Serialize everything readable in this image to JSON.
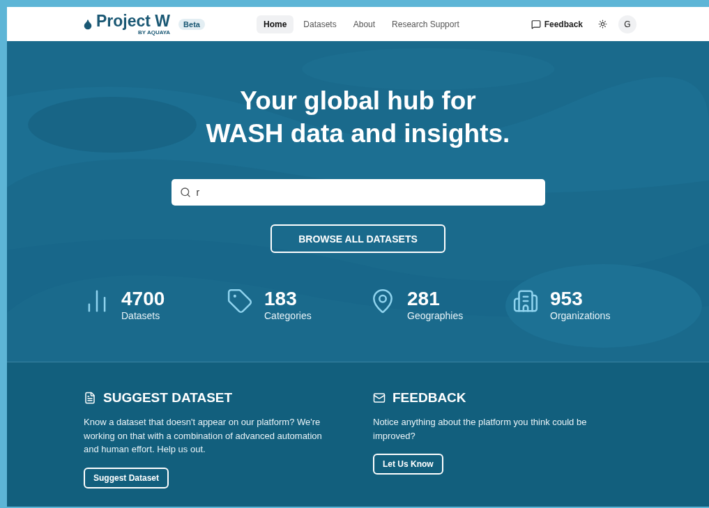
{
  "header": {
    "logo": "Project W",
    "logo_sub": "BY AQUAYA",
    "badge": "Beta",
    "nav": [
      {
        "label": "Home",
        "selected": true
      },
      {
        "label": "Datasets",
        "selected": false
      },
      {
        "label": "About",
        "selected": false
      },
      {
        "label": "Research Support",
        "selected": false
      }
    ],
    "feedback": "Feedback",
    "avatar": "G"
  },
  "hero": {
    "title_lines": [
      "Your global hub for",
      "WASH data and insights."
    ],
    "search": {
      "value": "r"
    },
    "browse_button": "BROWSE ALL DATASETS",
    "stats": [
      {
        "kind": "chart",
        "value": "4700",
        "label": "Datasets"
      },
      {
        "kind": "tag",
        "value": "183",
        "label": "Categories"
      },
      {
        "kind": "pin",
        "value": "281",
        "label": "Geographies"
      },
      {
        "kind": "building",
        "value": "953",
        "label": "Organizations"
      }
    ]
  },
  "cards": [
    {
      "kind": "file",
      "title": "SUGGEST DATASET",
      "text": "Know a dataset that doesn't appear on our platform? We're working on that with a combination of advanced automation and human effort. Help us out.",
      "button": "Suggest Dataset"
    },
    {
      "kind": "mail",
      "title": "FEEDBACK",
      "text": "Notice anything about the platform you think could be improved?",
      "button": "Let Us Know"
    }
  ]
}
